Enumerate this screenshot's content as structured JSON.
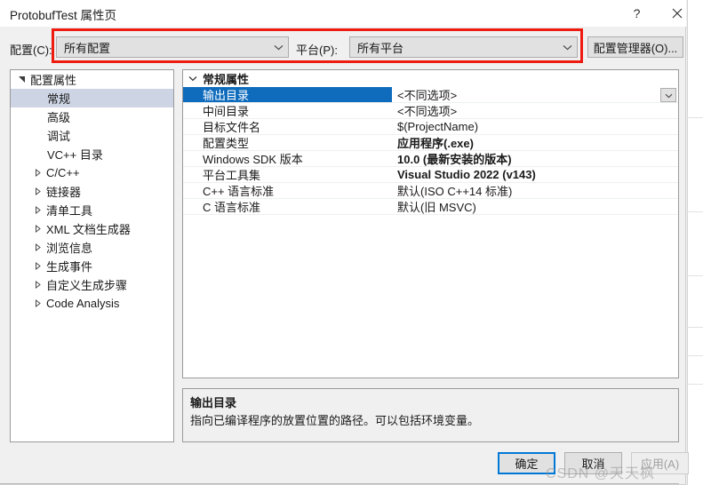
{
  "window": {
    "title": "ProtobufTest 属性页",
    "help_icon": "question-mark-icon",
    "help_glyph": "?",
    "close_icon": "close-icon"
  },
  "config_bar": {
    "configuration_label": "配置(C):",
    "configuration_value": "所有配置",
    "platform_label": "平台(P):",
    "platform_value": "所有平台",
    "config_manager_label": "配置管理器(O)...",
    "annotation_color": "#ee1b11"
  },
  "tree": {
    "items": [
      {
        "label": "配置属性",
        "level": 0,
        "arrow": "expanded",
        "selected": false
      },
      {
        "label": "常规",
        "level": 1,
        "arrow": "none",
        "selected": true
      },
      {
        "label": "高级",
        "level": 1,
        "arrow": "none",
        "selected": false
      },
      {
        "label": "调试",
        "level": 1,
        "arrow": "none",
        "selected": false
      },
      {
        "label": "VC++ 目录",
        "level": 1,
        "arrow": "none",
        "selected": false
      },
      {
        "label": "C/C++",
        "level": 1,
        "arrow": "collapsed",
        "selected": false
      },
      {
        "label": "链接器",
        "level": 1,
        "arrow": "collapsed",
        "selected": false
      },
      {
        "label": "清单工具",
        "level": 1,
        "arrow": "collapsed",
        "selected": false
      },
      {
        "label": "XML 文档生成器",
        "level": 1,
        "arrow": "collapsed",
        "selected": false
      },
      {
        "label": "浏览信息",
        "level": 1,
        "arrow": "collapsed",
        "selected": false
      },
      {
        "label": "生成事件",
        "level": 1,
        "arrow": "collapsed",
        "selected": false
      },
      {
        "label": "自定义生成步骤",
        "level": 1,
        "arrow": "collapsed",
        "selected": false
      },
      {
        "label": "Code Analysis",
        "level": 1,
        "arrow": "collapsed",
        "selected": false
      }
    ]
  },
  "grid": {
    "section_header": "常规属性",
    "section_state": "expanded",
    "rows": [
      {
        "name": "输出目录",
        "value": "<不同选项>",
        "bold": false,
        "selected": true,
        "dropdown": true
      },
      {
        "name": "中间目录",
        "value": "<不同选项>",
        "bold": false,
        "selected": false,
        "dropdown": false
      },
      {
        "name": "目标文件名",
        "value": "$(ProjectName)",
        "bold": false,
        "selected": false,
        "dropdown": false
      },
      {
        "name": "配置类型",
        "value": "应用程序(.exe)",
        "bold": true,
        "selected": false,
        "dropdown": false
      },
      {
        "name": "Windows SDK 版本",
        "value": "10.0 (最新安装的版本)",
        "bold": true,
        "selected": false,
        "dropdown": false
      },
      {
        "name": "平台工具集",
        "value": "Visual Studio 2022 (v143)",
        "bold": true,
        "selected": false,
        "dropdown": false
      },
      {
        "name": "C++ 语言标准",
        "value": "默认(ISO C++14 标准)",
        "bold": false,
        "selected": false,
        "dropdown": false
      },
      {
        "name": "C 语言标准",
        "value": "默认(旧 MSVC)",
        "bold": false,
        "selected": false,
        "dropdown": false
      }
    ]
  },
  "description": {
    "title": "输出目录",
    "body": "指向已编译程序的放置位置的路径。可以包括环境变量。"
  },
  "footer": {
    "ok_label": "确定",
    "cancel_label": "取消",
    "apply_label": "应用(A)"
  },
  "watermark": {
    "text": "CSDN @天天枫"
  }
}
